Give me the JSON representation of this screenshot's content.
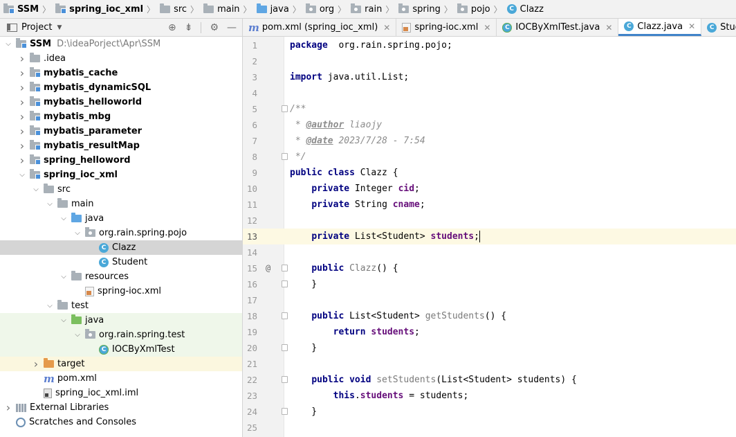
{
  "breadcrumbs": [
    {
      "label": "SSM",
      "icon": "module-icon",
      "bold": true
    },
    {
      "label": "spring_ioc_xml",
      "icon": "module-icon",
      "bold": true
    },
    {
      "label": "src",
      "icon": "folder-icon"
    },
    {
      "label": "main",
      "icon": "folder-icon"
    },
    {
      "label": "java",
      "icon": "source-folder-icon"
    },
    {
      "label": "org",
      "icon": "package-icon"
    },
    {
      "label": "rain",
      "icon": "package-icon"
    },
    {
      "label": "spring",
      "icon": "package-icon"
    },
    {
      "label": "pojo",
      "icon": "package-icon"
    },
    {
      "label": "Clazz",
      "icon": "class-icon"
    }
  ],
  "project_panel": {
    "title": "Project",
    "tools": [
      "crosshair-icon",
      "collapse-all-icon",
      "gear-icon",
      "hide-icon"
    ]
  },
  "tree": [
    {
      "label": "SSM",
      "extra": "D:\\ideaPorject\\Apr\\SSM",
      "indent": 0,
      "arrow": "down",
      "icon": "module",
      "bold": true
    },
    {
      "label": ".idea",
      "indent": 1,
      "arrow": "right",
      "icon": "folder"
    },
    {
      "label": "mybatis_cache",
      "indent": 1,
      "arrow": "right",
      "icon": "module",
      "bold": true
    },
    {
      "label": "mybatis_dynamicSQL",
      "indent": 1,
      "arrow": "right",
      "icon": "module",
      "bold": true
    },
    {
      "label": "mybatis_helloworld",
      "indent": 1,
      "arrow": "right",
      "icon": "module",
      "bold": true
    },
    {
      "label": "mybatis_mbg",
      "indent": 1,
      "arrow": "right",
      "icon": "module",
      "bold": true
    },
    {
      "label": "mybatis_parameter",
      "indent": 1,
      "arrow": "right",
      "icon": "module",
      "bold": true
    },
    {
      "label": "mybatis_resultMap",
      "indent": 1,
      "arrow": "right",
      "icon": "module",
      "bold": true
    },
    {
      "label": "spring_helloword",
      "indent": 1,
      "arrow": "right",
      "icon": "module",
      "bold": true
    },
    {
      "label": "spring_ioc_xml",
      "indent": 1,
      "arrow": "down",
      "icon": "module",
      "bold": true
    },
    {
      "label": "src",
      "indent": 2,
      "arrow": "down",
      "icon": "folder"
    },
    {
      "label": "main",
      "indent": 3,
      "arrow": "down",
      "icon": "folder"
    },
    {
      "label": "java",
      "indent": 4,
      "arrow": "down",
      "icon": "folder-blue"
    },
    {
      "label": "org.rain.spring.pojo",
      "indent": 5,
      "arrow": "down",
      "icon": "package"
    },
    {
      "label": "Clazz",
      "indent": 6,
      "arrow": "",
      "icon": "class",
      "selected": true
    },
    {
      "label": "Student",
      "indent": 6,
      "arrow": "",
      "icon": "class"
    },
    {
      "label": "resources",
      "indent": 4,
      "arrow": "down",
      "icon": "folder-res"
    },
    {
      "label": "spring-ioc.xml",
      "indent": 5,
      "arrow": "",
      "icon": "xml"
    },
    {
      "label": "test",
      "indent": 3,
      "arrow": "down",
      "icon": "folder"
    },
    {
      "label": "java",
      "indent": 4,
      "arrow": "down",
      "icon": "folder-green",
      "test": true
    },
    {
      "label": "org.rain.spring.test",
      "indent": 5,
      "arrow": "down",
      "icon": "package",
      "test": true
    },
    {
      "label": "IOCByXmlTest",
      "indent": 6,
      "arrow": "",
      "icon": "class-test",
      "test": true
    },
    {
      "label": "target",
      "indent": 2,
      "arrow": "right",
      "icon": "folder-orange",
      "excluded": true
    },
    {
      "label": "pom.xml",
      "indent": 2,
      "arrow": "",
      "icon": "maven"
    },
    {
      "label": "spring_ioc_xml.iml",
      "indent": 2,
      "arrow": "",
      "icon": "iml"
    },
    {
      "label": "External Libraries",
      "indent": 0,
      "arrow": "right",
      "icon": "lib"
    },
    {
      "label": "Scratches and Consoles",
      "indent": 0,
      "arrow": "",
      "icon": "scratch"
    }
  ],
  "tabs": [
    {
      "label": "pom.xml (spring_ioc_xml)",
      "icon": "maven"
    },
    {
      "label": "spring-ioc.xml",
      "icon": "xml"
    },
    {
      "label": "IOCByXmlTest.java",
      "icon": "class-test"
    },
    {
      "label": "Clazz.java",
      "icon": "class",
      "active": true
    },
    {
      "label": "Student.java",
      "icon": "class"
    }
  ],
  "editor": {
    "current_line": 13,
    "lines": [
      {
        "n": "1",
        "tokens": [
          [
            "kw",
            "package"
          ],
          [
            "",
            "  org.rain.spring.pojo;"
          ]
        ]
      },
      {
        "n": "2",
        "tokens": []
      },
      {
        "n": "3",
        "tokens": [
          [
            "kw",
            "import"
          ],
          [
            "",
            " java.util.List;"
          ]
        ]
      },
      {
        "n": "4",
        "tokens": []
      },
      {
        "n": "5",
        "fold": true,
        "tokens": [
          [
            "cm",
            "/**"
          ]
        ]
      },
      {
        "n": "6",
        "tokens": [
          [
            "cm",
            " * "
          ],
          [
            "tag",
            "@author"
          ],
          [
            "cm",
            " liaojy"
          ]
        ]
      },
      {
        "n": "7",
        "tokens": [
          [
            "cm",
            " * "
          ],
          [
            "tag",
            "@date"
          ],
          [
            "cm",
            " 2023/7/28 - 7:54"
          ]
        ]
      },
      {
        "n": "8",
        "fold": true,
        "tokens": [
          [
            "cm",
            " */"
          ]
        ]
      },
      {
        "n": "9",
        "tokens": [
          [
            "kw",
            "public class"
          ],
          [
            "",
            " Clazz {"
          ]
        ]
      },
      {
        "n": "10",
        "tokens": [
          [
            "",
            "    "
          ],
          [
            "kw",
            "private"
          ],
          [
            "",
            " Integer "
          ],
          [
            "fld",
            "cid"
          ],
          [
            "",
            ";"
          ]
        ]
      },
      {
        "n": "11",
        "tokens": [
          [
            "",
            "    "
          ],
          [
            "kw",
            "private"
          ],
          [
            "",
            " String "
          ],
          [
            "fld",
            "cname"
          ],
          [
            "",
            ";"
          ]
        ]
      },
      {
        "n": "12",
        "tokens": []
      },
      {
        "n": "13",
        "tokens": [
          [
            "",
            "    "
          ],
          [
            "kw",
            "private"
          ],
          [
            "",
            " List<Student> "
          ],
          [
            "fld",
            "students"
          ],
          [
            "",
            ";"
          ]
        ]
      },
      {
        "n": "14",
        "tokens": []
      },
      {
        "n": "15",
        "marker": "@",
        "fold": true,
        "tokens": [
          [
            "",
            "    "
          ],
          [
            "kw",
            "public"
          ],
          [
            "",
            " "
          ],
          [
            "decl",
            "Clazz"
          ],
          [
            "",
            "() {"
          ]
        ]
      },
      {
        "n": "16",
        "fold": true,
        "tokens": [
          [
            "",
            "    }"
          ]
        ]
      },
      {
        "n": "17",
        "tokens": []
      },
      {
        "n": "18",
        "fold": true,
        "tokens": [
          [
            "",
            "    "
          ],
          [
            "kw",
            "public"
          ],
          [
            "",
            " List<Student> "
          ],
          [
            "decl",
            "getStudents"
          ],
          [
            "",
            "() {"
          ]
        ]
      },
      {
        "n": "19",
        "tokens": [
          [
            "",
            "        "
          ],
          [
            "kw",
            "return"
          ],
          [
            "",
            " "
          ],
          [
            "fld",
            "students"
          ],
          [
            "",
            ";"
          ]
        ]
      },
      {
        "n": "20",
        "fold": true,
        "tokens": [
          [
            "",
            "    }"
          ]
        ]
      },
      {
        "n": "21",
        "tokens": []
      },
      {
        "n": "22",
        "fold": true,
        "tokens": [
          [
            "",
            "    "
          ],
          [
            "kw",
            "public void"
          ],
          [
            "",
            " "
          ],
          [
            "decl",
            "setStudents"
          ],
          [
            "",
            "(List<Student> students) {"
          ]
        ]
      },
      {
        "n": "23",
        "tokens": [
          [
            "",
            "        "
          ],
          [
            "kw",
            "this"
          ],
          [
            "",
            "."
          ],
          [
            "fld",
            "students"
          ],
          [
            "",
            " = students;"
          ]
        ]
      },
      {
        "n": "24",
        "fold": true,
        "tokens": [
          [
            "",
            "    }"
          ]
        ]
      },
      {
        "n": "25",
        "tokens": []
      }
    ]
  }
}
